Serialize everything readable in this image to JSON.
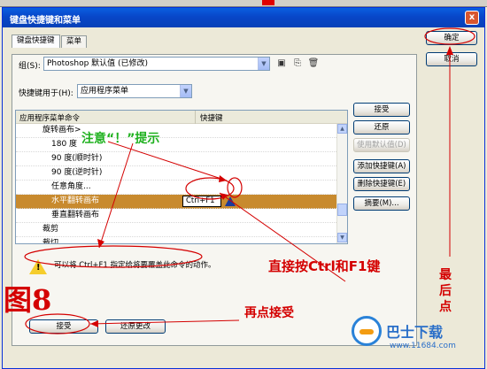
{
  "window": {
    "title": "键盘快捷键和菜单",
    "close_symbol": "x"
  },
  "tabs": [
    {
      "label": "键盘快捷键"
    },
    {
      "label": "菜单"
    }
  ],
  "set": {
    "label": "组(S):",
    "value": "Photoshop 默认值 (已修改)"
  },
  "shortcuts_for": {
    "label": "快捷键用于(H):",
    "value": "应用程序菜单"
  },
  "list": {
    "col_command": "应用程序菜单命令",
    "col_shortcut": "快捷键",
    "rows": [
      {
        "name": "旋转画布>",
        "shortcut": ""
      },
      {
        "name": "180 度",
        "shortcut": ""
      },
      {
        "name": "90 度(顺时针)",
        "shortcut": ""
      },
      {
        "name": "90 度(逆时针)",
        "shortcut": ""
      },
      {
        "name": "任意角度...",
        "shortcut": ""
      },
      {
        "name": "水平翻转画布",
        "shortcut": "Ctrl+F1"
      },
      {
        "name": "垂直翻转画布",
        "shortcut": ""
      },
      {
        "name": "裁剪",
        "shortcut": ""
      },
      {
        "name": "裁切...",
        "shortcut": ""
      }
    ]
  },
  "side_buttons": {
    "accept": "接受",
    "undo": "还原",
    "use_default": "使用默认值(D)",
    "add_shortcut": "添加快捷键(A)",
    "delete_shortcut": "删除快捷键(E)",
    "summarize": "摘要(M)..."
  },
  "dialog_buttons": {
    "ok": "确定",
    "cancel": "取消"
  },
  "warning": {
    "text": "可以将 Ctrl+F1 指定给将要覆盖此命令的动作。"
  },
  "bottom_buttons": {
    "accept": "接受",
    "undo_changes": "还原更改"
  },
  "annotations": {
    "attention": "注意“！”提示",
    "press_keys": "直接按Ctrl和F1键",
    "click_accept": "再点接受",
    "figure": "图8",
    "last_click": [
      "最",
      "后",
      "点"
    ],
    "annotation_color": "#d40000",
    "attention_color": "#1fb11f"
  },
  "watermark": {
    "site": "巴士下载",
    "url": "www.11684.com"
  },
  "colors": {
    "title_bar": "#0846c8",
    "selected_row": "#c88a2e",
    "warning_yellow": "#f5cd2c"
  }
}
